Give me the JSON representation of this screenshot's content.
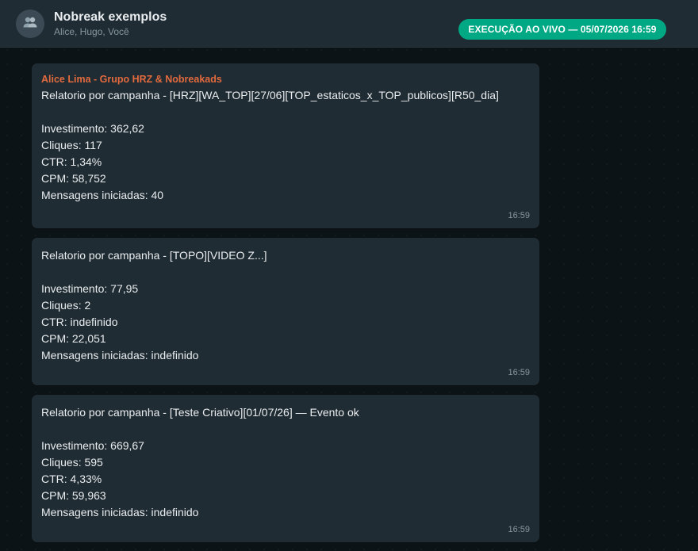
{
  "header": {
    "title": "Nobreak exemplos",
    "participants": "Alice, Hugo, Você",
    "live_badge": "EXECUÇÃO AO VIVO — 05/07/2026 16:59",
    "avatar_icon": "group-icon"
  },
  "colors": {
    "background": "#0c1317",
    "header": "#1f2c33",
    "bubble": "#202c33",
    "accent_green": "#00a884",
    "sender_name": "#e26a3e",
    "muted_text": "#8696a0"
  },
  "messages": [
    {
      "sender": "Alice Lima - Grupo HRZ & Nobreakads",
      "campaign": "Relatorio por campanha - [HRZ][WA_TOP][27/06][TOP_estaticos_x_TOP_publicos][R50_dia]",
      "investimento": "Investimento: 362,62",
      "cliques": "Cliques: 117",
      "ctr": "CTR: 1,34%",
      "cpm": "CPM: 58,752",
      "mensagens": "Mensagens iniciadas: 40",
      "time": "16:59"
    },
    {
      "campaign": "Relatorio por campanha - [TOPO][VIDEO Z...]",
      "investimento": "Investimento: 77,95",
      "cliques": "Cliques: 2",
      "ctr": "CTR: indefinido",
      "cpm": "CPM: 22,051",
      "mensagens": "Mensagens iniciadas: indefinido",
      "time": "16:59"
    },
    {
      "campaign": "Relatorio por campanha - [Teste Criativo][01/07/26] — Evento ok",
      "investimento": "Investimento: 669,67",
      "cliques": "Cliques: 595",
      "ctr": "CTR: 4,33%",
      "cpm": "CPM: 59,963",
      "mensagens": "Mensagens iniciadas: indefinido",
      "time": "16:59"
    }
  ]
}
